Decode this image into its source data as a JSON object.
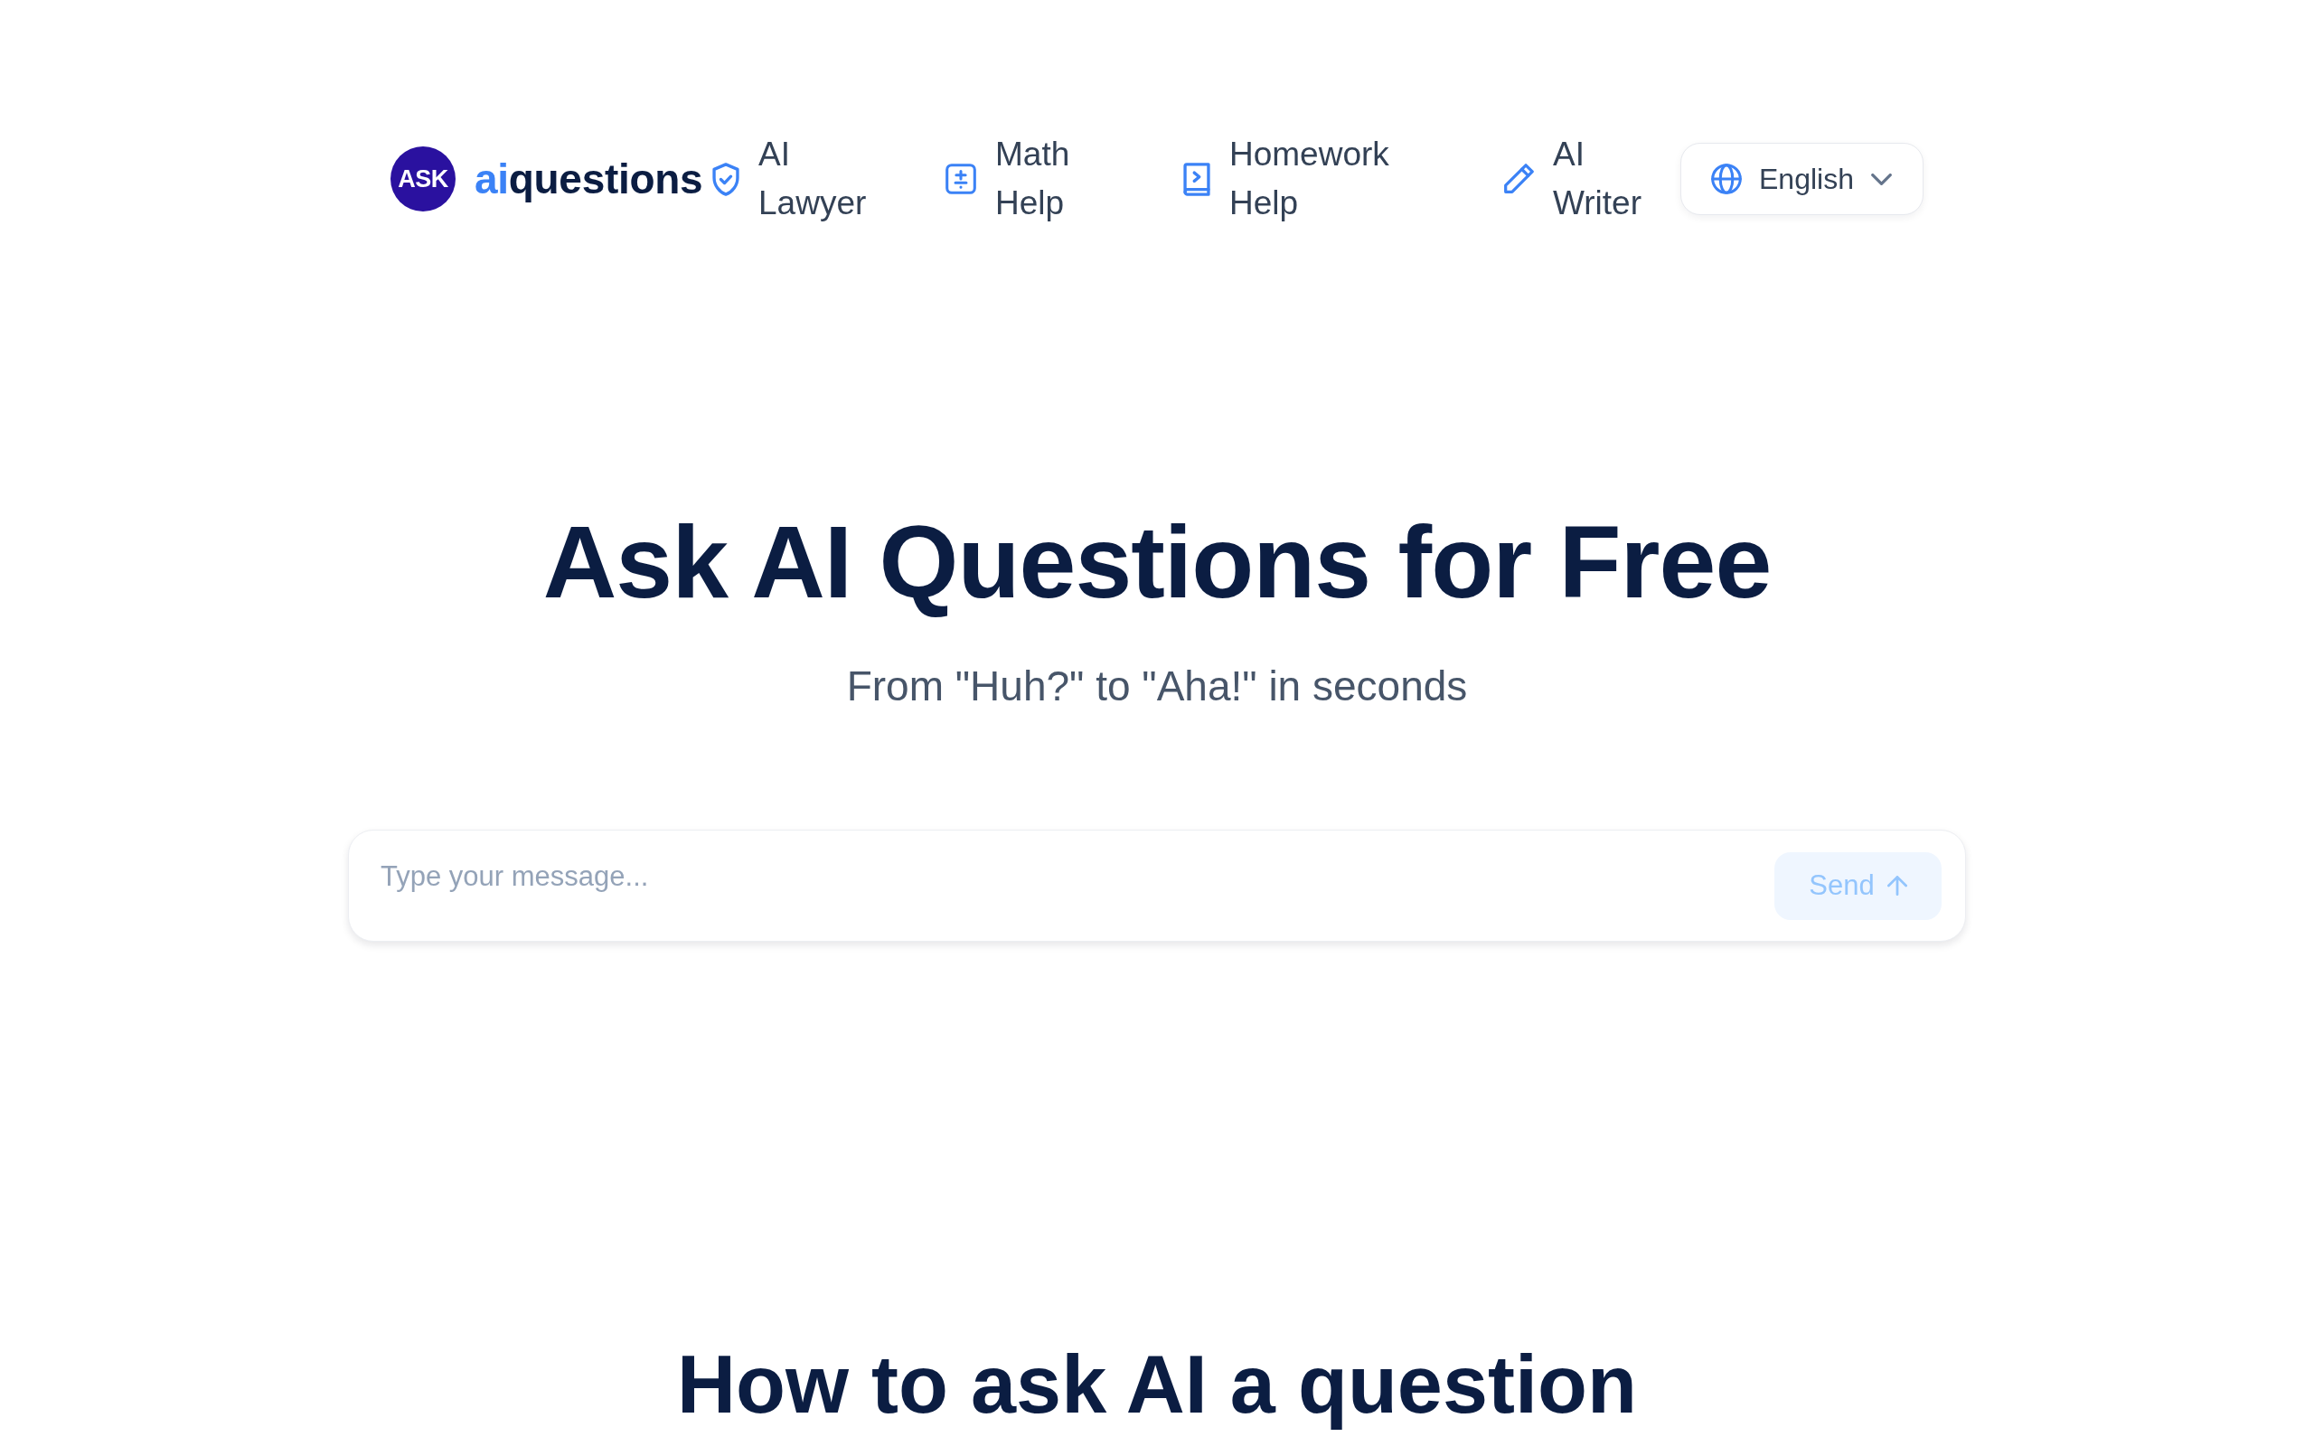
{
  "header": {
    "logo": {
      "badge": "ASK",
      "wordmark_accent": "ai",
      "wordmark": "questions"
    },
    "nav_links": [
      {
        "label": "AI Lawyer"
      },
      {
        "label": "Math Help"
      },
      {
        "label": "Homework Help"
      },
      {
        "label": "AI Writer"
      }
    ],
    "language_select": {
      "value": "English"
    }
  },
  "hero": {
    "title": "Ask AI Questions for Free",
    "subtitle": "From \"Huh?\" to \"Aha!\" in seconds"
  },
  "chat_input": {
    "placeholder": "Type your message...",
    "send_button": {
      "label": "Send",
      "disabled": true
    }
  },
  "next_section": {
    "title": "How to ask AI a question"
  }
}
